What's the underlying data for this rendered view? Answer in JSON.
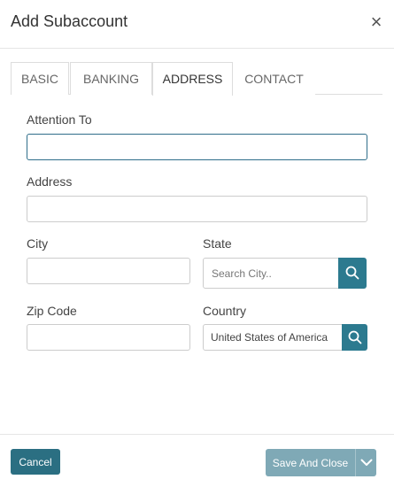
{
  "dialog": {
    "title": "Add Subaccount"
  },
  "tabs": [
    {
      "label": "BASIC"
    },
    {
      "label": "BANKING"
    },
    {
      "label": "ADDRESS"
    },
    {
      "label": "CONTACT"
    }
  ],
  "active_tab": "ADDRESS",
  "form": {
    "attention_label": "Attention To",
    "attention_value": "",
    "address_label": "Address",
    "address_value": "",
    "city_label": "City",
    "city_value": "",
    "state_label": "State",
    "state_placeholder": "Search City..",
    "zip_label": "Zip Code",
    "zip_value": "",
    "country_label": "Country",
    "country_value": "United States of America"
  },
  "footer": {
    "cancel_label": "Cancel",
    "save_label": "Save And Close"
  },
  "colors": {
    "accent": "#2c7a8f",
    "cancel_bg": "#2b6f82",
    "save_disabled_bg": "#7fa9b6"
  },
  "icons": [
    "close-icon",
    "search-icon",
    "chevron-down-icon"
  ]
}
